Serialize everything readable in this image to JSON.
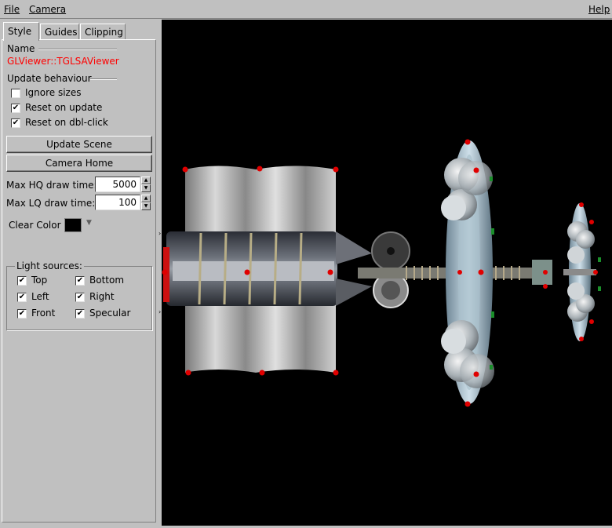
{
  "menubar": {
    "file": "File",
    "camera": "Camera",
    "help": "Help"
  },
  "tabs": [
    "Style",
    "Guides",
    "Clipping"
  ],
  "style": {
    "name_label": "Name",
    "name_value": "GLViewer::TGLSAViewer",
    "update_label": "Update behaviour",
    "ignore_sizes": "Ignore sizes",
    "reset_on_update": "Reset on update",
    "reset_on_dblclick": "Reset on dbl-click",
    "update_scene": "Update Scene",
    "camera_home": "Camera Home",
    "max_hq_label": "Max HQ draw time:",
    "max_hq_value": "5000",
    "max_lq_label": "Max LQ draw time:",
    "max_lq_value": "100",
    "clear_color_label": "Clear Color",
    "clear_color": "#000000",
    "light_sources_label": "Light sources:",
    "lights": {
      "top": "Top",
      "bottom": "Bottom",
      "left": "Left",
      "right": "Right",
      "front": "Front",
      "specular": "Specular"
    }
  },
  "check_mark": "✔"
}
